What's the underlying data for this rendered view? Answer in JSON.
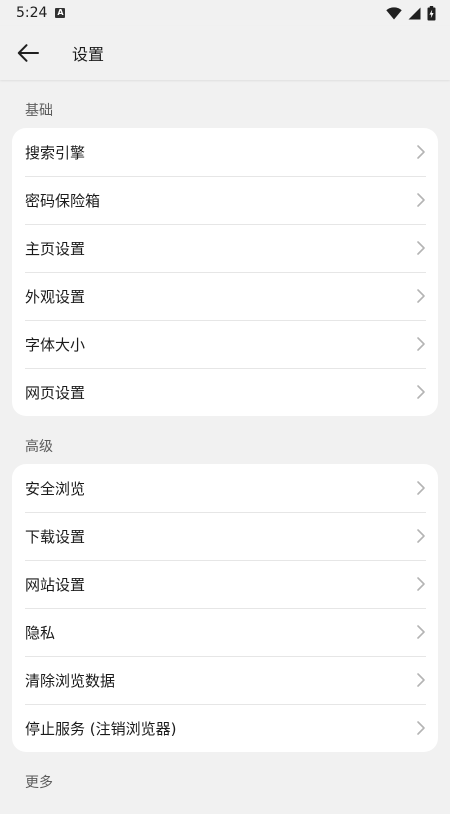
{
  "status_bar": {
    "time": "5:24",
    "notification_badge": "A"
  },
  "app_bar": {
    "title": "设置"
  },
  "sections": [
    {
      "header": "基础",
      "items": [
        {
          "label": "搜索引擎"
        },
        {
          "label": "密码保险箱"
        },
        {
          "label": "主页设置"
        },
        {
          "label": "外观设置"
        },
        {
          "label": "字体大小"
        },
        {
          "label": "网页设置"
        }
      ]
    },
    {
      "header": "高级",
      "items": [
        {
          "label": "安全浏览"
        },
        {
          "label": "下载设置"
        },
        {
          "label": "网站设置"
        },
        {
          "label": "隐私"
        },
        {
          "label": "清除浏览数据"
        },
        {
          "label": "停止服务 (注销浏览器)"
        }
      ]
    },
    {
      "header": "更多",
      "items": []
    }
  ],
  "icons": {
    "back": "arrow-left-icon",
    "row_chevron": "chevron-right-icon",
    "wifi": "wifi-icon",
    "signal": "cellular-signal-icon",
    "battery": "battery-charging-icon"
  },
  "colors": {
    "background": "#f1f1f1",
    "card": "#ffffff",
    "divider": "#e6e6e6",
    "text": "#1b1b1b",
    "secondary_text": "#5c5c5c",
    "chevron": "#b4b4b4"
  }
}
